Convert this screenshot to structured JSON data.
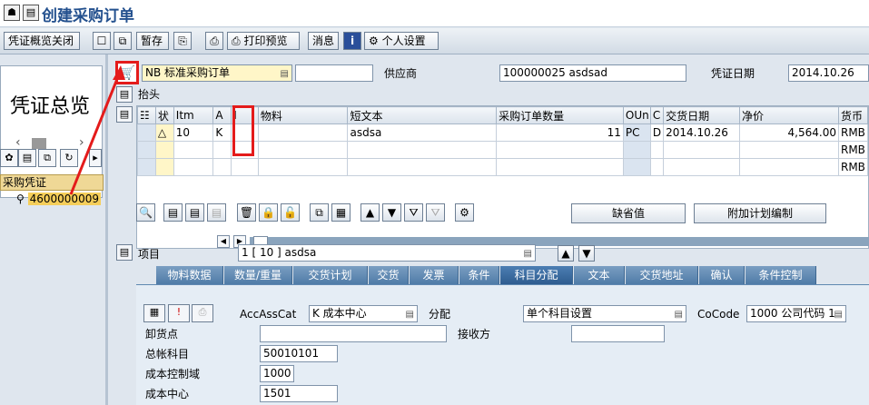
{
  "window": {
    "title": "创建采购订单"
  },
  "toolbar": {
    "close_overview": "凭证概览关闭",
    "hold": "暂存",
    "print_preview": "打印预览",
    "messages": "消息",
    "personal_settings": "个人设置"
  },
  "left": {
    "summary_title": "凭证总览",
    "tree_header": "采购凭证",
    "tree_item": "4600000009"
  },
  "header": {
    "doc_type": "NB 标准采购订单",
    "vendor_label": "供应商",
    "vendor_value": "100000025 asdsad",
    "doc_date_label": "凭证日期",
    "doc_date_value": "2014.10.26",
    "section_label": "抬头"
  },
  "grid": {
    "columns": [
      "状",
      "Itm",
      "A",
      "I",
      "物料",
      "短文本",
      "采购订单数量",
      "OUn",
      "C",
      "交货日期",
      "净价",
      "货币"
    ],
    "rows": [
      {
        "status": "△",
        "itm": "10",
        "a": "K",
        "i": "",
        "material": "",
        "text": "asdsa",
        "qty": "11",
        "oun": "PC",
        "c": "D",
        "date": "2014.10.26",
        "price": "4,564.00",
        "curr": "RMB"
      },
      {
        "status": "",
        "itm": "",
        "a": "",
        "i": "",
        "material": "",
        "text": "",
        "qty": "",
        "oun": "",
        "c": "",
        "date": "",
        "price": "",
        "curr": "RMB"
      },
      {
        "status": "",
        "itm": "",
        "a": "",
        "i": "",
        "material": "",
        "text": "",
        "qty": "",
        "oun": "",
        "c": "",
        "date": "",
        "price": "",
        "curr": "RMB"
      }
    ]
  },
  "grid_buttons": {
    "defaults": "缺省值",
    "extra_plan": "附加计划编制"
  },
  "item": {
    "label": "项目",
    "selected": "1 [ 10 ] asdsa"
  },
  "tabs": [
    "物料数据",
    "数量/重量",
    "交货计划",
    "交货",
    "发票",
    "条件",
    "科目分配",
    "文本",
    "交货地址",
    "确认",
    "条件控制"
  ],
  "account": {
    "acc_cat_label": "AccAssCat",
    "acc_cat_value": "K 成本中心",
    "distribution_label": "分配",
    "distribution_value": "单个科目设置",
    "cocode_label": "CoCode",
    "cocode_value": "1000 公司代码 1",
    "unloading_label": "卸货点",
    "unloading_value": "",
    "recipient_label": "接收方",
    "recipient_value": "",
    "gl_label": "总帐科目",
    "gl_value": "50010101",
    "co_area_label": "成本控制域",
    "co_area_value": "1000",
    "cost_center_label": "成本中心",
    "cost_center_value": "1501"
  },
  "colors": {
    "annotation": "#e41b1b",
    "tab_active": "#2e5c8f",
    "header_bg": "#dfe6ee"
  }
}
